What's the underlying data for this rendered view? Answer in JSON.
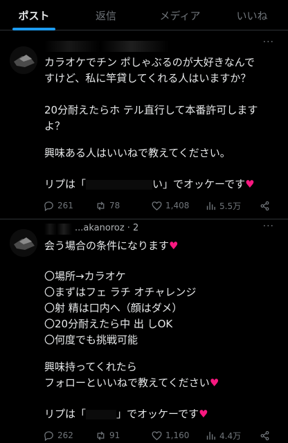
{
  "tabs": [
    {
      "label": "ポスト",
      "active": true
    },
    {
      "label": "返信",
      "active": false
    },
    {
      "label": "メディア",
      "active": false
    },
    {
      "label": "いいね",
      "active": false
    }
  ],
  "posts": [
    {
      "header_text": "",
      "lines": [
        "カラオケでチン ポしゃぶるのが大好きなんで",
        "すけど、私に竿貸してくれる人はいますか？",
        "",
        "20分耐えたらホ テル直行して本番許可します",
        "よ？",
        "",
        "興味ある人はいいねで教えてください。",
        "",
        "リプは「",
        "い」でオッケーです"
      ],
      "stats": {
        "replies": "261",
        "reposts": "78",
        "likes": "1,408",
        "views": "5.5万"
      }
    },
    {
      "header_text": "...akanoroz · 2",
      "lines": [
        "会う場合の条件になります",
        "",
        "〇場所→カラオケ",
        "〇まずはフェ ラチ オチャレンジ",
        "〇射 精は口内へ（顔はダメ）",
        "〇20分耐えたら中 出 しOK",
        "〇何度でも挑戦可能",
        "",
        "興味持ってくれたら",
        "フォローといいねで教えてください",
        "",
        "リプは「",
        "」でオッケーです"
      ],
      "stats": {
        "replies": "262",
        "reposts": "91",
        "likes": "1,160",
        "views": "4.4万"
      }
    }
  ],
  "colors": {
    "background": "#000000",
    "text": "#e7e9ea",
    "muted": "#71767b",
    "accent": "#1d9bf0",
    "heart": "#f91880",
    "divider": "#2f3336"
  },
  "icons": [
    "reply-icon",
    "repost-icon",
    "like-icon",
    "views-icon",
    "share-icon",
    "more-icon"
  ]
}
